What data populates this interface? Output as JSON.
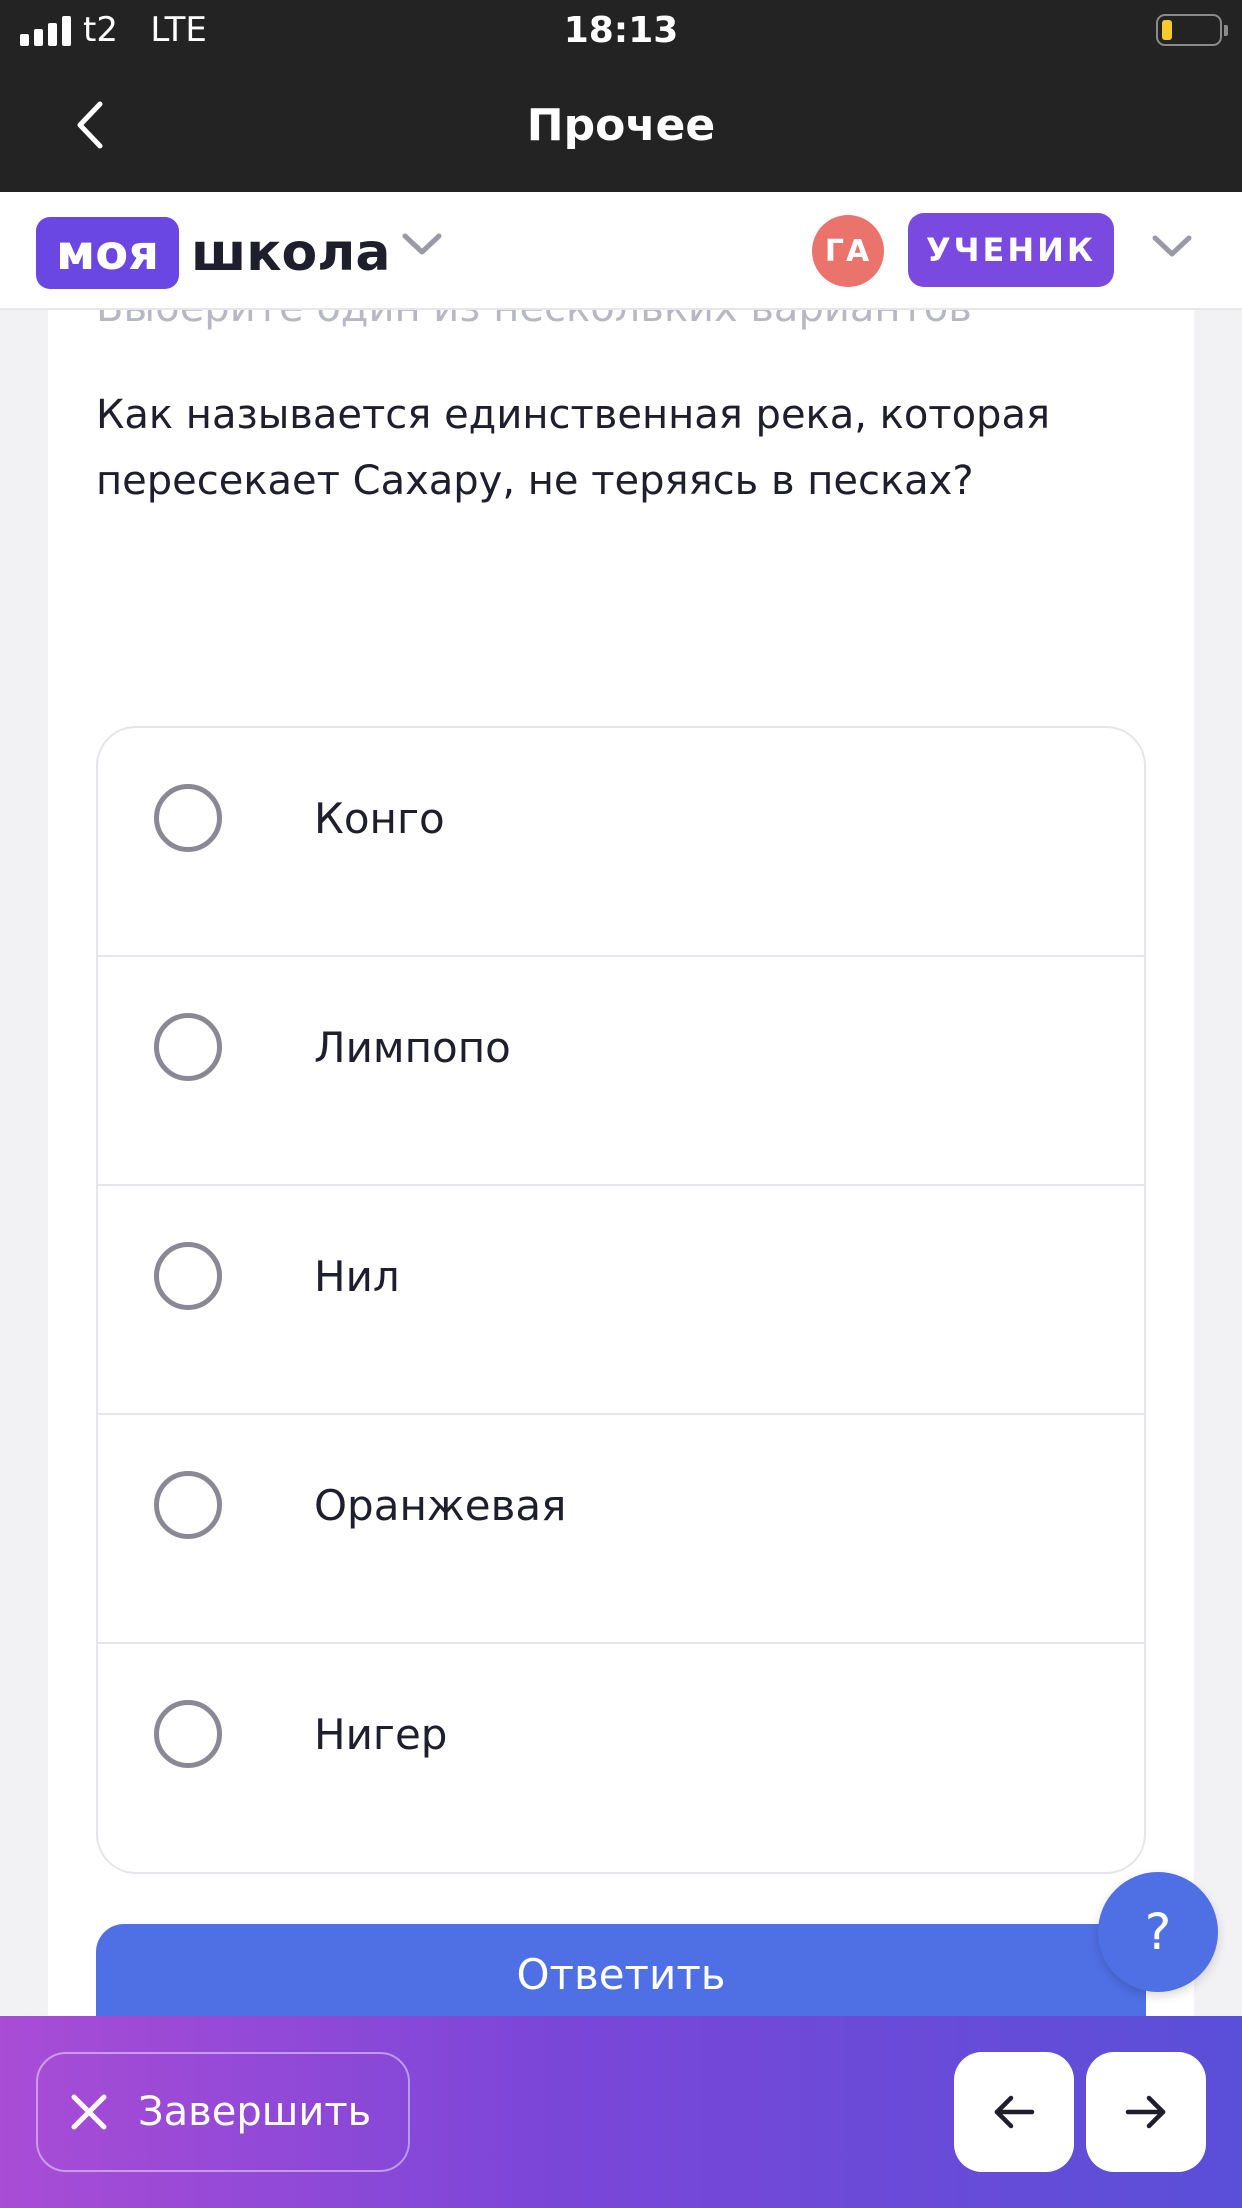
{
  "status_bar": {
    "carrier": "t2",
    "network": "LTE",
    "time": "18:13"
  },
  "nav": {
    "title": "Прочее"
  },
  "header": {
    "logo_part1": "моя",
    "logo_part2": "школа",
    "avatar_initials": "ГА",
    "role_label": "УЧЕНИК"
  },
  "quiz": {
    "hint": "Выберите один из нескольких вариантов",
    "question": "Как называется единственная река, которая пересекает Сахару, не теряясь в песках?",
    "options": [
      {
        "label": "Конго"
      },
      {
        "label": "Лимпопо"
      },
      {
        "label": "Нил"
      },
      {
        "label": "Оранжевая"
      },
      {
        "label": "Нигер"
      }
    ],
    "answer_label": "Ответить"
  },
  "help": {
    "label": "?"
  },
  "bottom_bar": {
    "finish_label": "Завершить"
  },
  "colors": {
    "accent_purple": "#6a46e2",
    "answer_blue": "#4f6fe4",
    "avatar_red": "#ea746c",
    "dark_bar": "#232323"
  }
}
